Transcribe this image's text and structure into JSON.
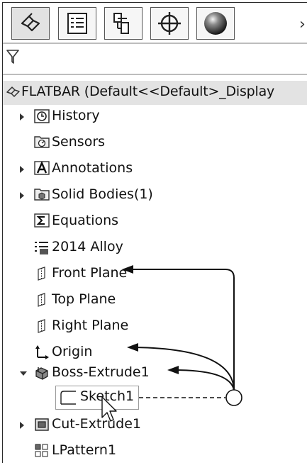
{
  "tabs": [
    {
      "name": "featuremanager",
      "icon": "featuremanager-icon",
      "active": true
    },
    {
      "name": "propertymanager",
      "icon": "propertymanager-icon",
      "active": false
    },
    {
      "name": "configurationmanager",
      "icon": "configurationmanager-icon",
      "active": false
    },
    {
      "name": "dimxpertmanager",
      "icon": "dimxpert-crosshair-icon",
      "active": false
    },
    {
      "name": "displaymanager",
      "icon": "display-sphere-icon",
      "active": false
    }
  ],
  "more_tabs_glyph": "›",
  "filter_icon": "filter-icon",
  "root": {
    "label": "FLATBAR  (Default<<Default>_Display",
    "icon": "part-icon"
  },
  "tree": {
    "history": "History",
    "sensors": "Sensors",
    "annotations": "Annotations",
    "solid_bodies": "Solid Bodies(1)",
    "equations": "Equations",
    "material": "2014 Alloy",
    "front_plane": "Front Plane",
    "top_plane": "Top Plane",
    "right_plane": "Right Plane",
    "origin": "Origin",
    "boss_extrude": "Boss-Extrude1",
    "sketch": "Sketch1",
    "cut_extrude": "Cut-Extrude1",
    "lpattern": "LPattern1"
  }
}
